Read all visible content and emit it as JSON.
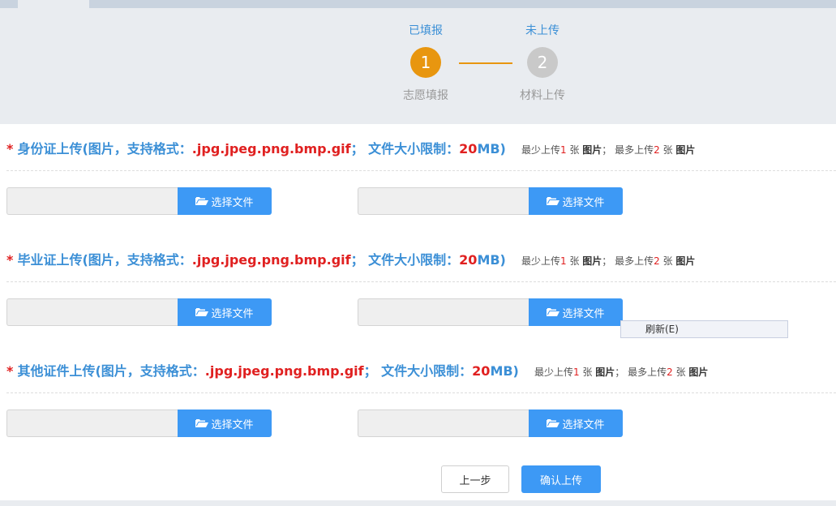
{
  "steps": [
    {
      "status": "已填报",
      "number": "1",
      "name": "志愿填报",
      "state": "done"
    },
    {
      "status": "未上传",
      "number": "2",
      "name": "材料上传",
      "state": "todo"
    }
  ],
  "sections": [
    {
      "required_mark": "*",
      "title_prefix": "身份证上传(图片，支持格式：",
      "formats": ".jpg.jpeg.png.bmp.gif",
      "title_mid": "；  文件大小限制：",
      "size_num": "20",
      "size_unit": "MB)",
      "hint_min_prefix": "最少上传",
      "hint_min_num": "1",
      "hint_min_suffix": " 张 ",
      "hint_unit": "图片",
      "hint_sep": "；  最多上传",
      "hint_max_num": "2",
      "hint_max_suffix": " 张 ",
      "buttons": [
        "选择文件",
        "选择文件"
      ]
    },
    {
      "required_mark": "*",
      "title_prefix": "毕业证上传(图片，支持格式：",
      "formats": ".jpg.jpeg.png.bmp.gif",
      "title_mid": "；  文件大小限制：",
      "size_num": "20",
      "size_unit": "MB)",
      "hint_min_prefix": "最少上传",
      "hint_min_num": "1",
      "hint_min_suffix": " 张 ",
      "hint_unit": "图片",
      "hint_sep": "；  最多上传",
      "hint_max_num": "2",
      "hint_max_suffix": " 张 ",
      "buttons": [
        "选择文件",
        "选择文件"
      ]
    },
    {
      "required_mark": "*",
      "title_prefix": "其他证件上传(图片，支持格式：",
      "formats": ".jpg.jpeg.png.bmp.gif",
      "title_mid": "；  文件大小限制：",
      "size_num": "20",
      "size_unit": "MB)",
      "hint_min_prefix": "最少上传",
      "hint_min_num": "1",
      "hint_min_suffix": " 张 ",
      "hint_unit": "图片",
      "hint_sep": "；  最多上传",
      "hint_max_num": "2",
      "hint_max_suffix": " 张 ",
      "buttons": [
        "选择文件",
        "选择文件"
      ]
    }
  ],
  "context_menu": {
    "item": "刷新(E)"
  },
  "actions": {
    "prev": "上一步",
    "confirm": "确认上传"
  },
  "colors": {
    "accent": "#3d99f5",
    "done": "#e8960f",
    "required": "#e02020",
    "title": "#3b8fd6"
  }
}
